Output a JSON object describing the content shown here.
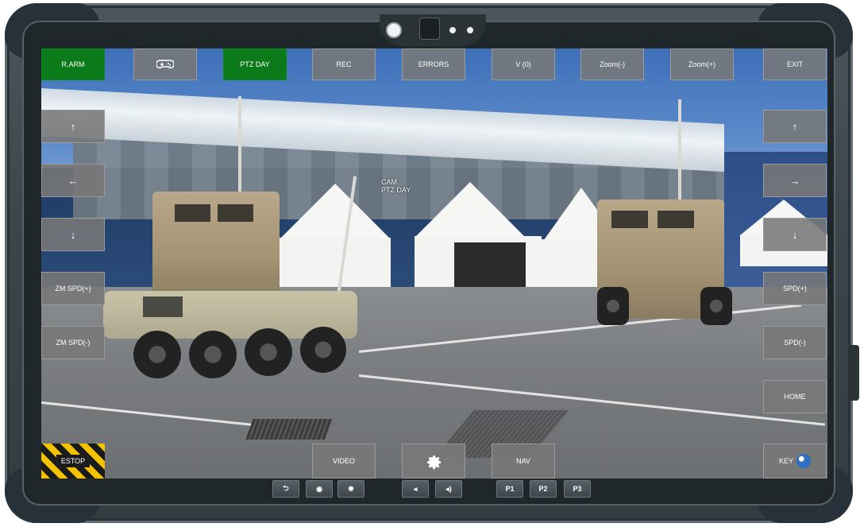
{
  "top_bar": [
    {
      "id": "r-arm",
      "label": "R.ARM",
      "active": true
    },
    {
      "id": "gamepad",
      "label": "",
      "icon": "gamepad-icon",
      "active": false
    },
    {
      "id": "ptz-day",
      "label": "PTZ DAY",
      "active": true
    },
    {
      "id": "rec",
      "label": "REC",
      "active": false
    },
    {
      "id": "errors",
      "label": "ERRORS",
      "active": false
    },
    {
      "id": "v",
      "label": "V (0)",
      "active": false
    },
    {
      "id": "zoom-minus",
      "label": "Zoom(-)",
      "active": false
    },
    {
      "id": "zoom-plus",
      "label": "Zoom(+)",
      "active": false
    },
    {
      "id": "exit",
      "label": "EXIT",
      "active": false
    }
  ],
  "left_panel": [
    {
      "id": "left-up",
      "label": "↑"
    },
    {
      "id": "left-left",
      "label": "←"
    },
    {
      "id": "left-down",
      "label": "↓"
    },
    {
      "id": "zm-spd-plus",
      "label": "ZM SPD(+)"
    },
    {
      "id": "zm-spd-minus",
      "label": "ZM SPD(-)"
    }
  ],
  "right_panel": [
    {
      "id": "right-up",
      "label": "↑"
    },
    {
      "id": "right-right",
      "label": "→"
    },
    {
      "id": "right-down",
      "label": "↓"
    },
    {
      "id": "spd-plus",
      "label": "SPD(+)"
    },
    {
      "id": "spd-minus",
      "label": "SPD(-)"
    },
    {
      "id": "home",
      "label": "HOME"
    }
  ],
  "bottom_panel": {
    "estop": "ESTOP",
    "video": "VIDEO",
    "nav": "NAV",
    "key": "KEY"
  },
  "camera_overlay": {
    "line1": "CAM",
    "line2": "PTZ DAY"
  },
  "bezel_buttons": [
    {
      "id": "back",
      "label": "⮌",
      "icon": "back-icon"
    },
    {
      "id": "circle",
      "label": "◉",
      "icon": "record-icon"
    },
    {
      "id": "brightness",
      "label": "✹",
      "icon": "brightness-icon"
    },
    {
      "id": "vol-down",
      "label": "◂",
      "icon": "volume-down-icon"
    },
    {
      "id": "vol-up",
      "label": "◂)",
      "icon": "volume-up-icon"
    },
    {
      "id": "p1",
      "label": "P1"
    },
    {
      "id": "p2",
      "label": "P2"
    },
    {
      "id": "p3",
      "label": "P3"
    }
  ],
  "colors": {
    "active_green": "#0b7a19",
    "button_gray": "#787878",
    "estop_yellow": "#f2c200"
  }
}
